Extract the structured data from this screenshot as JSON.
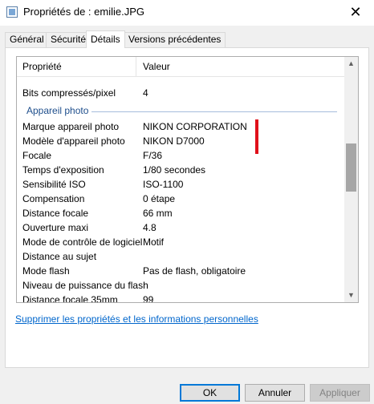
{
  "window": {
    "title": "Propriétés de : emilie.JPG",
    "close_glyph": "✕"
  },
  "tabs": [
    {
      "label": "Général",
      "active": false
    },
    {
      "label": "Sécurité",
      "active": false
    },
    {
      "label": "Détails",
      "active": true
    },
    {
      "label": "Versions précédentes",
      "active": false
    }
  ],
  "details": {
    "header": {
      "property": "Propriété",
      "value": "Valeur"
    },
    "rows_top": [
      {
        "name": "Bits compressés/pixel",
        "value": "4"
      }
    ],
    "group": "Appareil photo",
    "rows": [
      {
        "name": "Marque appareil photo",
        "value": "NIKON CORPORATION"
      },
      {
        "name": "Modèle d'appareil photo",
        "value": "NIKON D7000"
      },
      {
        "name": "Focale",
        "value": "F/36"
      },
      {
        "name": "Temps d'exposition",
        "value": "1/80 secondes"
      },
      {
        "name": "Sensibilité ISO",
        "value": "ISO-1100"
      },
      {
        "name": "Compensation",
        "value": "0 étape"
      },
      {
        "name": "Distance focale",
        "value": "66 mm"
      },
      {
        "name": "Ouverture maxi",
        "value": "4.8"
      },
      {
        "name": "Mode de contrôle de logiciel",
        "value": "Motif"
      },
      {
        "name": "Distance au sujet",
        "value": ""
      },
      {
        "name": "Mode flash",
        "value": "Pas de flash, obligatoire"
      },
      {
        "name": "Niveau de puissance du flash",
        "value": ""
      },
      {
        "name": "Distance focale 35mm",
        "value": "99"
      }
    ],
    "scroll_up_glyph": "▲",
    "scroll_down_glyph": "▼"
  },
  "link": "Supprimer les propriétés et les informations personnelles",
  "buttons": {
    "ok": "OK",
    "cancel": "Annuler",
    "apply": "Appliquer"
  },
  "colors": {
    "accent": "#0078d7",
    "link": "#0066cc",
    "group_header": "#1e4e8c",
    "highlight_marker": "#e0101a"
  },
  "icons": {
    "window_icon": "file-icon",
    "close": "close-icon"
  }
}
